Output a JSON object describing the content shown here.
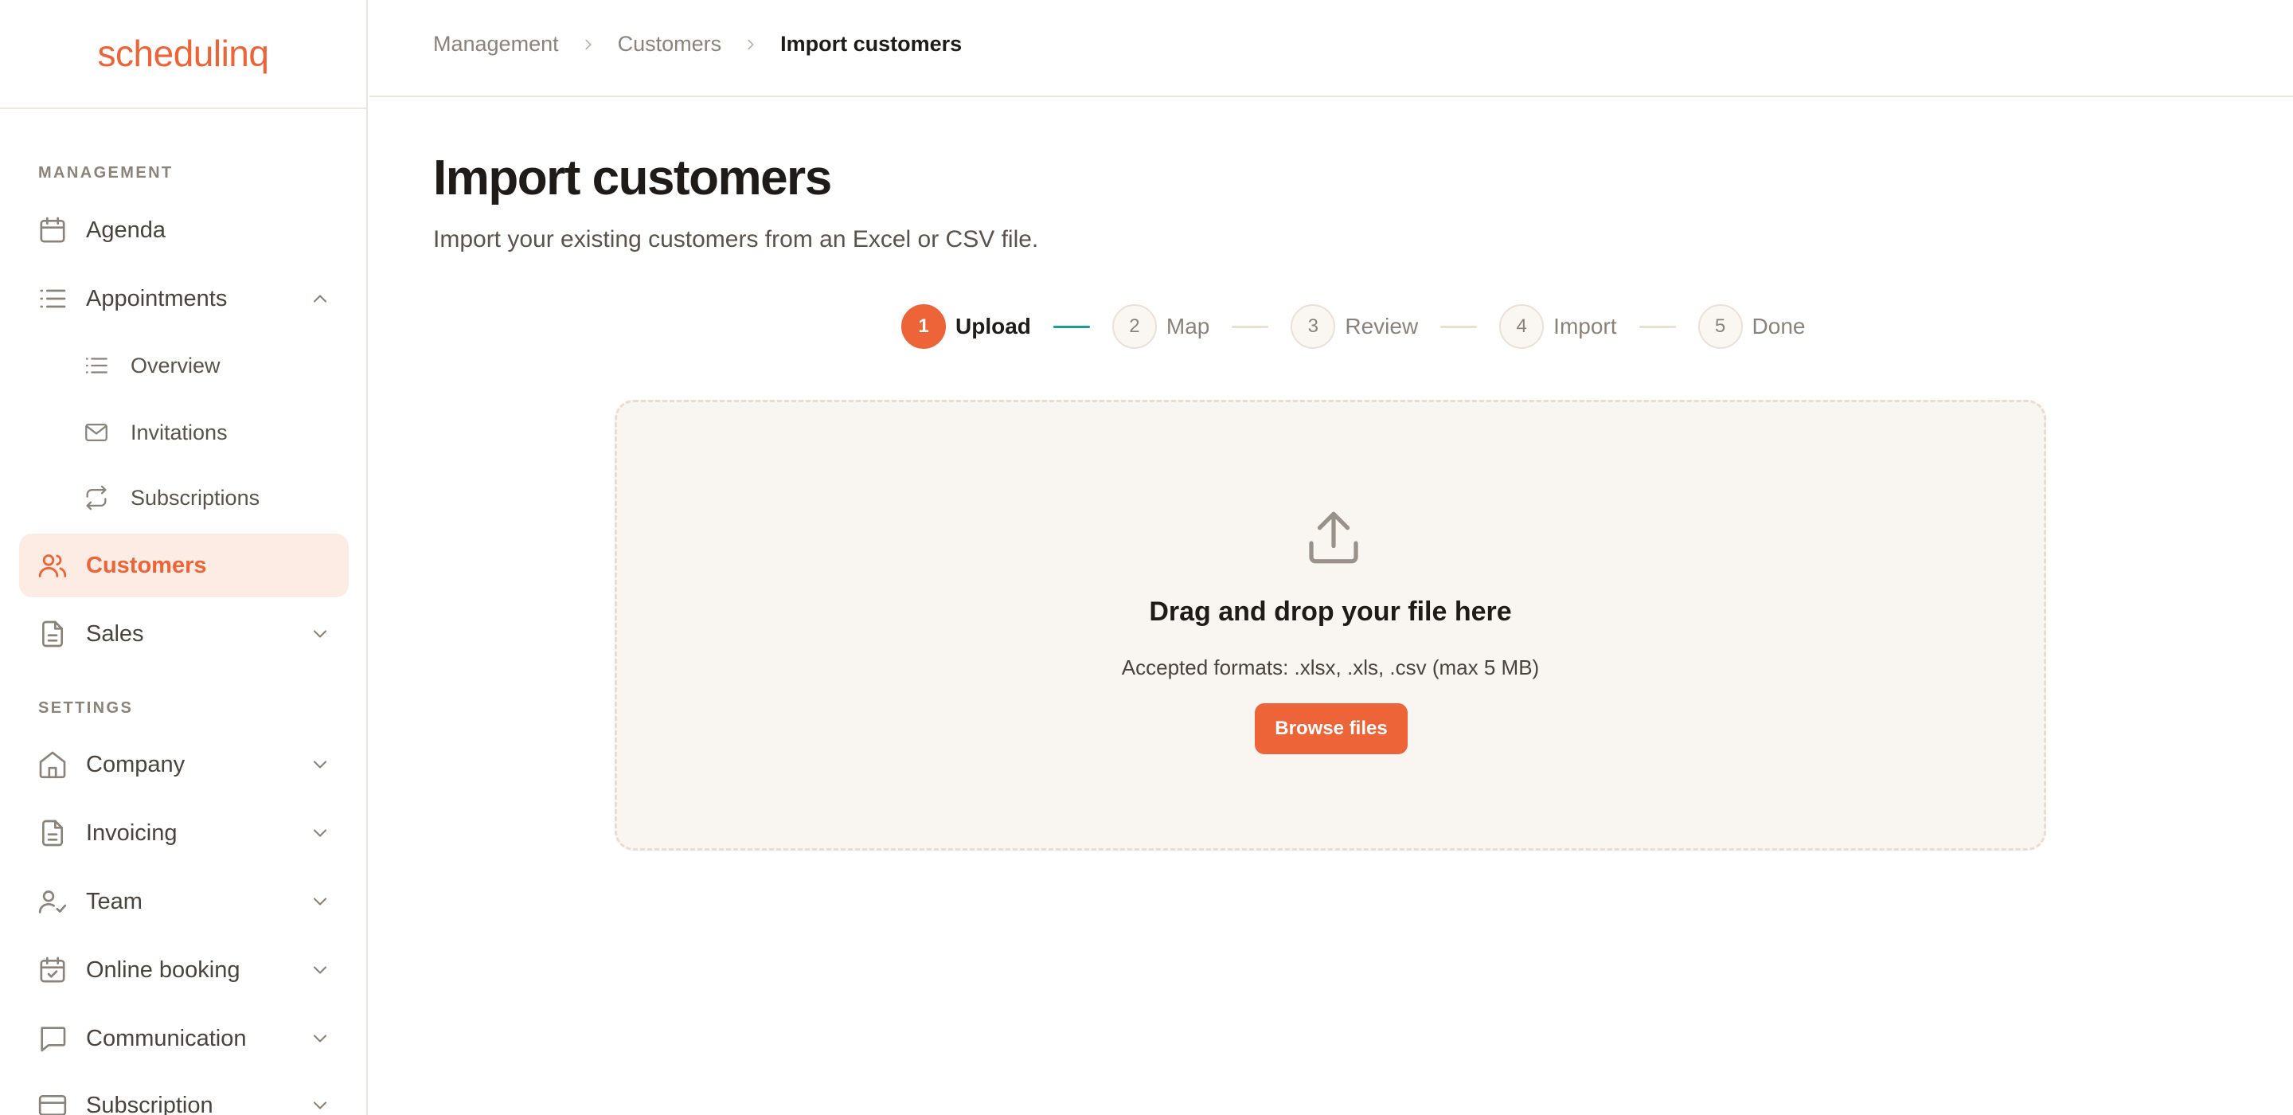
{
  "app": {
    "logo_text": "schedulinq",
    "accent_color": "#ec6437",
    "success_color": "#1a9e8f"
  },
  "sidebar": {
    "management_label": "MANAGEMENT",
    "settings_label": "SETTINGS",
    "items": [
      {
        "label": "Agenda",
        "icon": "calendar-icon"
      },
      {
        "label": "Appointments",
        "icon": "list-icon",
        "expanded": true
      },
      {
        "label": "Overview",
        "icon": "list-icon"
      },
      {
        "label": "Invitations",
        "icon": "mail-icon"
      },
      {
        "label": "Subscriptions",
        "icon": "repeat-icon"
      },
      {
        "label": "Customers",
        "icon": "users-icon",
        "active": true
      },
      {
        "label": "Sales",
        "icon": "document-icon"
      },
      {
        "label": "Company",
        "icon": "home-icon"
      },
      {
        "label": "Invoicing",
        "icon": "document-icon"
      },
      {
        "label": "Team",
        "icon": "user-check-icon"
      },
      {
        "label": "Online booking",
        "icon": "calendar-check-icon"
      },
      {
        "label": "Communication",
        "icon": "chat-icon"
      },
      {
        "label": "Subscription",
        "icon": "credit-card-icon"
      }
    ]
  },
  "breadcrumb": {
    "items": [
      "Management",
      "Customers"
    ],
    "current": "Import customers"
  },
  "main": {
    "title": "Import customers",
    "subtitle": "Import your existing customers from an Excel or CSV file."
  },
  "stepper": {
    "steps": [
      {
        "number": "1",
        "label": "Upload",
        "active": true
      },
      {
        "number": "2",
        "label": "Map"
      },
      {
        "number": "3",
        "label": "Review"
      },
      {
        "number": "4",
        "label": "Import"
      },
      {
        "number": "5",
        "label": "Done"
      }
    ]
  },
  "dropzone": {
    "title": "Drag and drop your file here",
    "formats": "Accepted formats: .xlsx, .xls, .csv (max 5 MB)",
    "browse_label": "Browse files",
    "icon": "upload-icon"
  }
}
